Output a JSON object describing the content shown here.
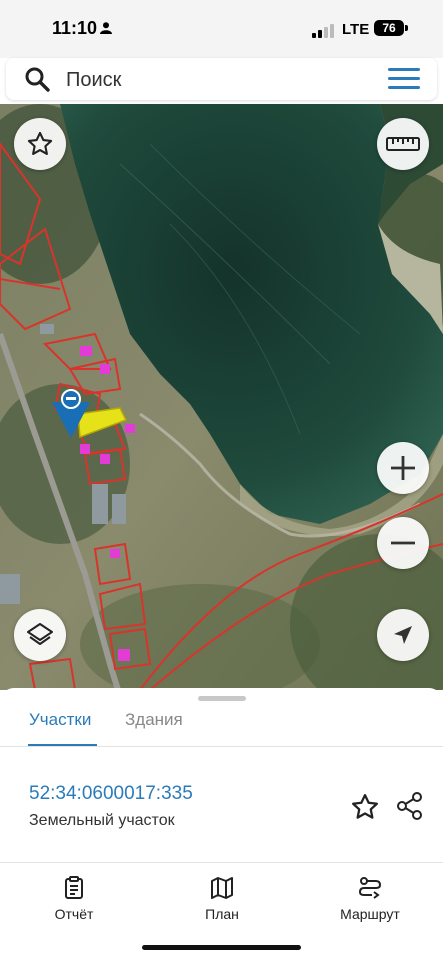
{
  "status": {
    "time": "11:10",
    "network": "LTE",
    "battery": "76"
  },
  "search": {
    "placeholder": "Поиск"
  },
  "map": {
    "icons": [
      "star-icon",
      "ruler-icon",
      "zoom-in-icon",
      "zoom-out-icon",
      "layers-icon",
      "location-arrow-icon",
      "map-pin-icon"
    ],
    "colors": {
      "parcel_border": "#d9342b",
      "selected_parcel": "#e6e21a",
      "building": "#e23bd6",
      "water": "#1f4a3c"
    }
  },
  "sheet": {
    "tabs": [
      {
        "label": "Участки",
        "active": true
      },
      {
        "label": "Здания",
        "active": false
      }
    ],
    "parcel": {
      "number": "52:34:0600017:335",
      "type": "Земельный участок"
    },
    "accent": "#2b7bb9"
  },
  "bottom_nav": {
    "items": [
      {
        "label": "Отчёт",
        "icon": "report-icon"
      },
      {
        "label": "План",
        "icon": "map-plan-icon"
      },
      {
        "label": "Маршрут",
        "icon": "route-icon"
      }
    ]
  }
}
